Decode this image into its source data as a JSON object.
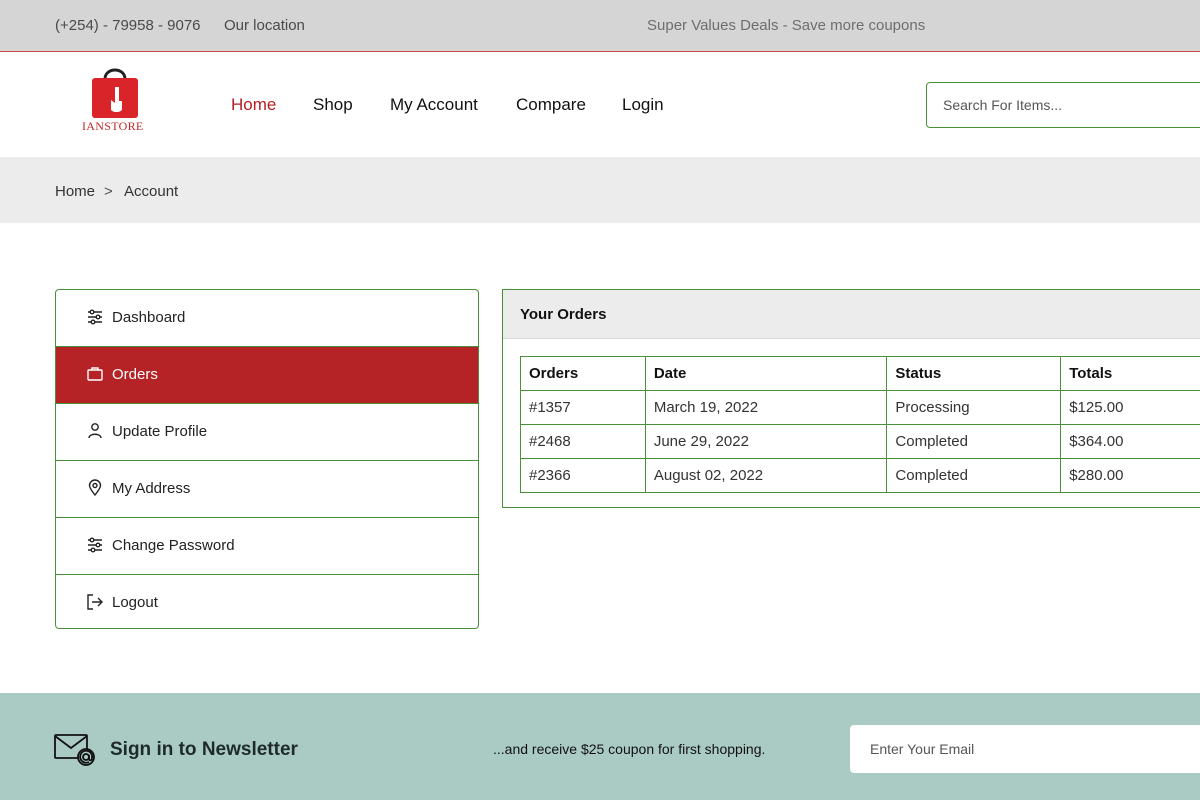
{
  "topbar": {
    "phone": "(+254) - 79958 - 9076",
    "location": "Our location",
    "deals": "Super Values Deals - Save more coupons"
  },
  "header": {
    "logo_text": "IANSTORE",
    "logo_icon": "shopping-bag-icon",
    "nav": [
      {
        "label": "Home",
        "active": true
      },
      {
        "label": "Shop",
        "active": false
      },
      {
        "label": "My Account",
        "active": false
      },
      {
        "label": "Compare",
        "active": false
      },
      {
        "label": "Login",
        "active": false
      }
    ],
    "search_placeholder": "Search For Items..."
  },
  "breadcrumb": {
    "items": [
      "Home",
      "Account"
    ],
    "separator": ">"
  },
  "sidebar": {
    "items": [
      {
        "label": "Dashboard",
        "icon": "sliders-icon",
        "active": false
      },
      {
        "label": "Orders",
        "icon": "shopping-bag-icon",
        "active": true
      },
      {
        "label": "Update Profile",
        "icon": "user-icon",
        "active": false
      },
      {
        "label": "My Address",
        "icon": "map-pin-icon",
        "active": false
      },
      {
        "label": "Change Password",
        "icon": "sliders-icon",
        "active": false
      },
      {
        "label": "Logout",
        "icon": "logout-icon",
        "active": false
      }
    ]
  },
  "orders": {
    "title": "Your Orders",
    "columns": [
      "Orders",
      "Date",
      "Status",
      "Totals"
    ],
    "rows": [
      {
        "id": "#1357",
        "date": "March 19, 2022",
        "status": "Processing",
        "total": "$125.00"
      },
      {
        "id": "#2468",
        "date": "June 29, 2022",
        "status": "Completed",
        "total": "$364.00"
      },
      {
        "id": "#2366",
        "date": "August 02, 2022",
        "status": "Completed",
        "total": "$280.00"
      }
    ]
  },
  "newsletter": {
    "icon": "mail-at-icon",
    "title": "Sign in to Newsletter",
    "subtitle": "...and receive $25 coupon for first shopping.",
    "email_placeholder": "Enter Your Email"
  },
  "colors": {
    "accent": "#b52326",
    "border_green": "#4a8f3a",
    "topbar_bg": "#d5d5d5",
    "band_bg": "#ececec",
    "newsletter_bg": "#aacbc4"
  }
}
